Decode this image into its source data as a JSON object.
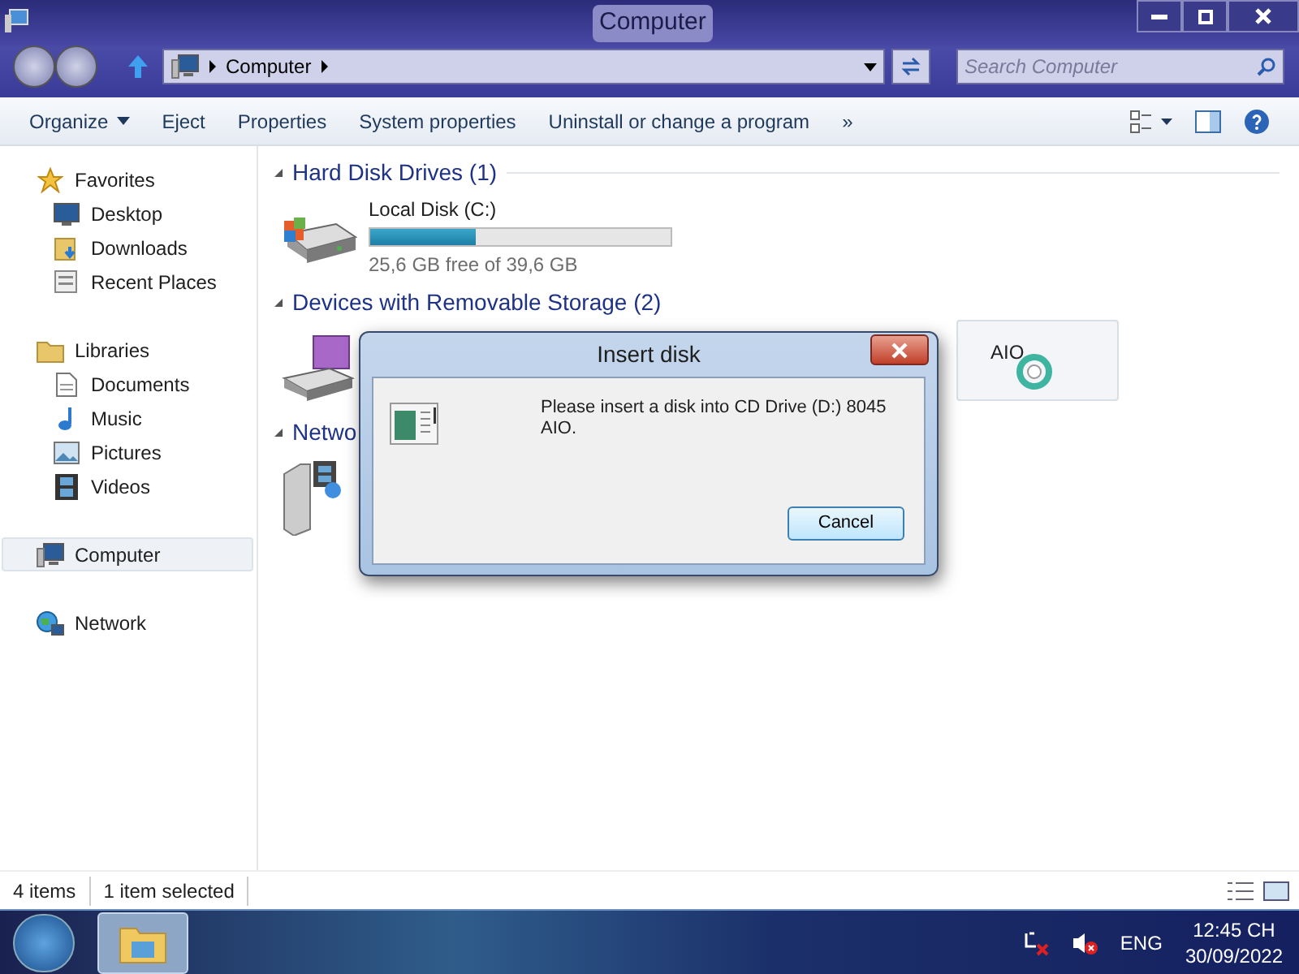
{
  "window": {
    "title": "Computer"
  },
  "address": {
    "crumbs": [
      "Computer"
    ]
  },
  "search": {
    "placeholder": "Search Computer"
  },
  "toolbar": {
    "items": [
      {
        "label": "Organize",
        "kind": "menu"
      },
      {
        "label": "Eject",
        "kind": "button"
      },
      {
        "label": "Properties",
        "kind": "button"
      },
      {
        "label": "System properties",
        "kind": "button"
      },
      {
        "label": "Uninstall or change a program",
        "kind": "button"
      },
      {
        "label": "»",
        "kind": "button"
      }
    ]
  },
  "sidebar": {
    "groups": [
      {
        "label": "Favorites",
        "kind": "star",
        "selected": false,
        "children": [
          {
            "label": "Desktop",
            "kind": "desktop",
            "selected": false
          },
          {
            "label": "Downloads",
            "kind": "downloads",
            "selected": false
          },
          {
            "label": "Recent Places",
            "kind": "recent",
            "selected": false
          }
        ]
      },
      {
        "label": "Libraries",
        "kind": "folder",
        "selected": false,
        "children": [
          {
            "label": "Documents",
            "kind": "document",
            "selected": false
          },
          {
            "label": "Music",
            "kind": "music",
            "selected": false
          },
          {
            "label": "Pictures",
            "kind": "picture",
            "selected": false
          },
          {
            "label": "Videos",
            "kind": "video",
            "selected": false
          }
        ]
      },
      {
        "label": "Computer",
        "kind": "computer",
        "selected": true
      },
      {
        "label": "Network",
        "kind": "network",
        "selected": false
      }
    ]
  },
  "sections": [
    {
      "title": "Hard Disk Drives (1)",
      "items": [
        {
          "kind": "disk",
          "name": "Local Disk (C:)",
          "level": 0.35,
          "reading": "25,6 GB free of 39,6 GB",
          "selected": false
        }
      ]
    },
    {
      "title": "Devices with Removable Storage (2)",
      "items": [
        {
          "kind": "floppy",
          "selected": false
        },
        {
          "kind": "cd",
          "name": "AIO",
          "selected": true
        }
      ]
    },
    {
      "title": "Netwo",
      "items": [
        {
          "kind": "media",
          "selected": false
        }
      ]
    }
  ],
  "dialog": {
    "title": "Insert disk",
    "message": "Please insert a disk into CD Drive (D:) 8045 AIO.",
    "buttons": [
      "Cancel"
    ]
  },
  "status_bar": {
    "texts": [
      "4 items",
      "1 item selected"
    ]
  },
  "taskbar": {
    "language": "ENG",
    "time": "12:45 CH",
    "date": "30/09/2022"
  }
}
